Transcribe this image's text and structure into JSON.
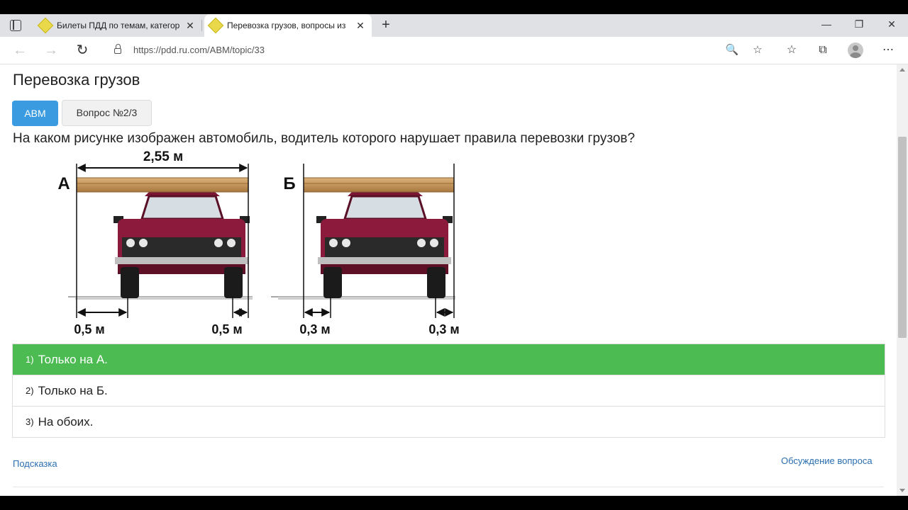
{
  "browser": {
    "tabs": [
      {
        "title": "Билеты ПДД по темам, категор",
        "close": "✕"
      },
      {
        "title": "Перевозка грузов, вопросы из",
        "close": "✕"
      }
    ],
    "new_tab": "+",
    "window_controls": {
      "minimize": "—",
      "restore": "❐",
      "close": "✕"
    },
    "nav": {
      "back": "←",
      "forward": "→",
      "reload": "↻"
    },
    "url": "https://pdd.ru.com/ABM/topic/33",
    "icons": {
      "zoom": "🔍",
      "favorite_add": "☆",
      "favorites": "☆",
      "collections": "⧉",
      "menu": "⋯"
    }
  },
  "page": {
    "title": "Перевозка грузов",
    "category_button": "ABM",
    "question_counter": "Вопрос №2/3",
    "question": "На каком рисунке изображен автомобиль, водитель которого нарушает правила перевозки грузов?",
    "figure": {
      "a_label": "А",
      "b_label": "Б",
      "a_top_width": "2,55 м",
      "a_left_overhang": "0,5 м",
      "a_right_overhang": "0,5 м",
      "b_left_overhang": "0,3 м",
      "b_right_overhang": "0,3 м"
    },
    "answers": [
      {
        "num": "1)",
        "text": "Только на А.",
        "correct": true
      },
      {
        "num": "2)",
        "text": "Только на Б.",
        "correct": false
      },
      {
        "num": "3)",
        "text": "На обоих.",
        "correct": false
      }
    ],
    "hint_link": "Подсказка",
    "discussion_link": "Обсуждение вопроса"
  },
  "colors": {
    "accent": "#3a9be0",
    "correct": "#4cbb52",
    "car": "#8b1a3c",
    "cargo": "#c79a5a"
  }
}
